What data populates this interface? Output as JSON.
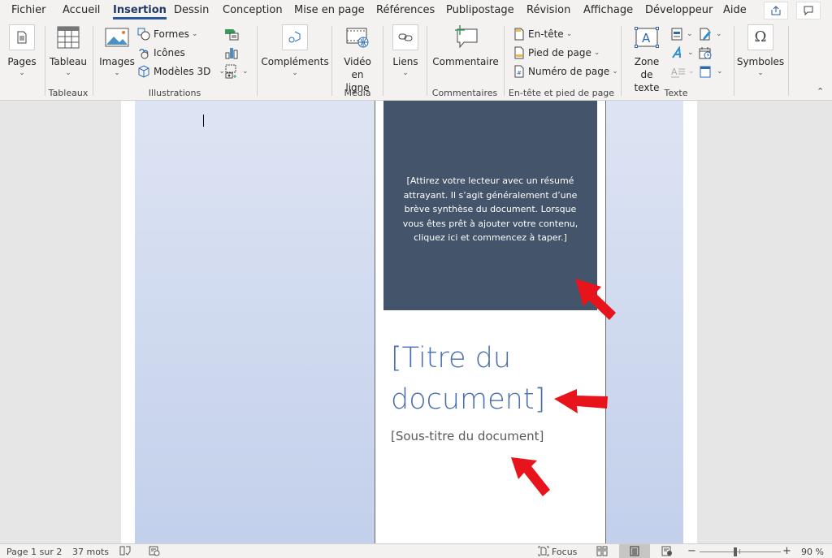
{
  "tabs": [
    {
      "label": "Fichier",
      "active": false
    },
    {
      "label": "Accueil",
      "active": false
    },
    {
      "label": "Insertion",
      "active": true
    },
    {
      "label": "Dessin",
      "active": false
    },
    {
      "label": "Conception",
      "active": false
    },
    {
      "label": "Mise en page",
      "active": false
    },
    {
      "label": "Références",
      "active": false
    },
    {
      "label": "Publipostage",
      "active": false
    },
    {
      "label": "Révision",
      "active": false
    },
    {
      "label": "Affichage",
      "active": false
    },
    {
      "label": "Développeur",
      "active": false
    },
    {
      "label": "Aide",
      "active": false
    }
  ],
  "top_buttons": {
    "share_icon": "share-icon",
    "comments_icon": "comment-icon"
  },
  "ribbon": {
    "pages": {
      "label": "Pages",
      "icon": "page-icon"
    },
    "tableaux": {
      "group_label": "Tableaux",
      "tableau_label": "Tableau",
      "icon": "table-icon"
    },
    "illustrations": {
      "group_label": "Illustrations",
      "images_label": "Images",
      "formes_label": "Formes",
      "icones_label": "Icônes",
      "modeles3d_label": "Modèles 3D",
      "smartart_icon": "smartart-icon",
      "graphique_icon": "chart-icon",
      "capture_icon": "screenshot-icon"
    },
    "complements": {
      "label": "Compléments",
      "icon": "addins-icon"
    },
    "media": {
      "group_label": "Média",
      "video_label_line1": "Vidéo",
      "video_label_line2": "en ligne",
      "icon": "online-video-icon"
    },
    "liens": {
      "label": "Liens",
      "icon": "link-icon"
    },
    "commentaires": {
      "group_label": "Commentaires",
      "commentaire_label": "Commentaire",
      "icon": "new-comment-icon"
    },
    "entete": {
      "group_label": "En-tête et pied de page",
      "entete_label": "En-tête",
      "pied_label": "Pied de page",
      "numero_label": "Numéro de page"
    },
    "texte": {
      "group_label": "Texte",
      "zone_label_line1": "Zone de",
      "zone_label_line2": "texte",
      "quickparts_icon": "quick-parts-icon",
      "wordart_icon": "wordart-icon",
      "dropcap_icon": "drop-cap-icon",
      "signature_icon": "signature-line-icon",
      "datetime_icon": "date-time-icon",
      "object_icon": "object-icon"
    },
    "symboles": {
      "label": "Symboles",
      "icon": "omega-icon"
    }
  },
  "document": {
    "summary": "[Attirez votre lecteur avec un résumé attrayant. Il s’agit généralement d’une brève synthèse du document. Lorsque vous êtes prêt à ajouter votre contenu, cliquez ici et commencez à taper.]",
    "title": "[Titre du document]",
    "subtitle": "[Sous-titre du document]",
    "annotation_color": "#e8141c",
    "summary_bg": "#44546a",
    "title_color": "#4a6fae"
  },
  "status": {
    "page": "Page 1 sur 2",
    "words": "37 mots",
    "focus": "Focus",
    "zoom": "90 %",
    "zoom_minus": "−",
    "zoom_plus": "+",
    "zoom_level_percent": 90
  }
}
